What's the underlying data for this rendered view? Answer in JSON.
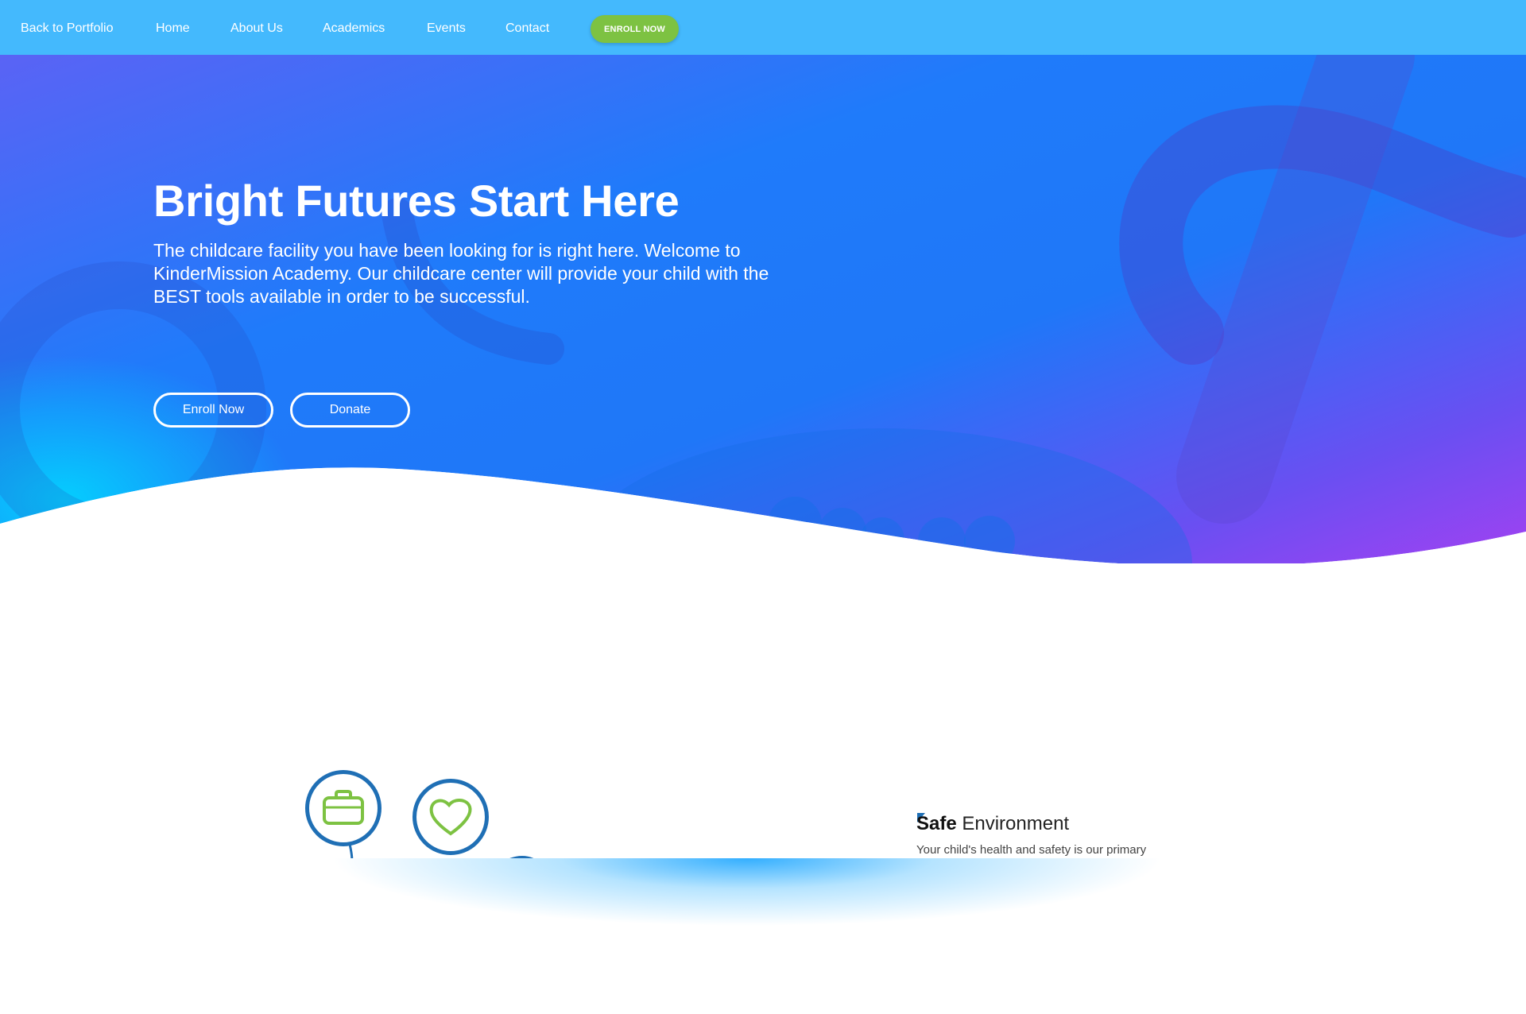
{
  "nav": {
    "back": "Back to Portfolio",
    "home": "Home",
    "about": "About Us",
    "academics": "Academics",
    "events": "Events",
    "contact": "Contact",
    "enroll": "ENROLL NOW"
  },
  "hero": {
    "title": "Bright Futures Start Here",
    "text": "The childcare facility you have been looking for is right here. Welcome to KinderMission Academy. Our childcare center will provide your child with the BEST tools available in order to be successful.",
    "enroll_button": "Enroll Now",
    "donate_button": "Donate"
  },
  "feature": {
    "title_bold": "Safe",
    "title_rest": " Environment",
    "text": "Your child's health and safety is our primary"
  },
  "icons": [
    "briefcase-icon",
    "heart-icon"
  ],
  "colors": {
    "nav_bg": "#44b9fd",
    "enroll_pill": "#7dc242",
    "icon_ring": "#1f6fb5",
    "icon_glyph": "#7dc242",
    "hero_gradient_start": "#5a63f5",
    "hero_gradient_end": "#a241f1"
  }
}
